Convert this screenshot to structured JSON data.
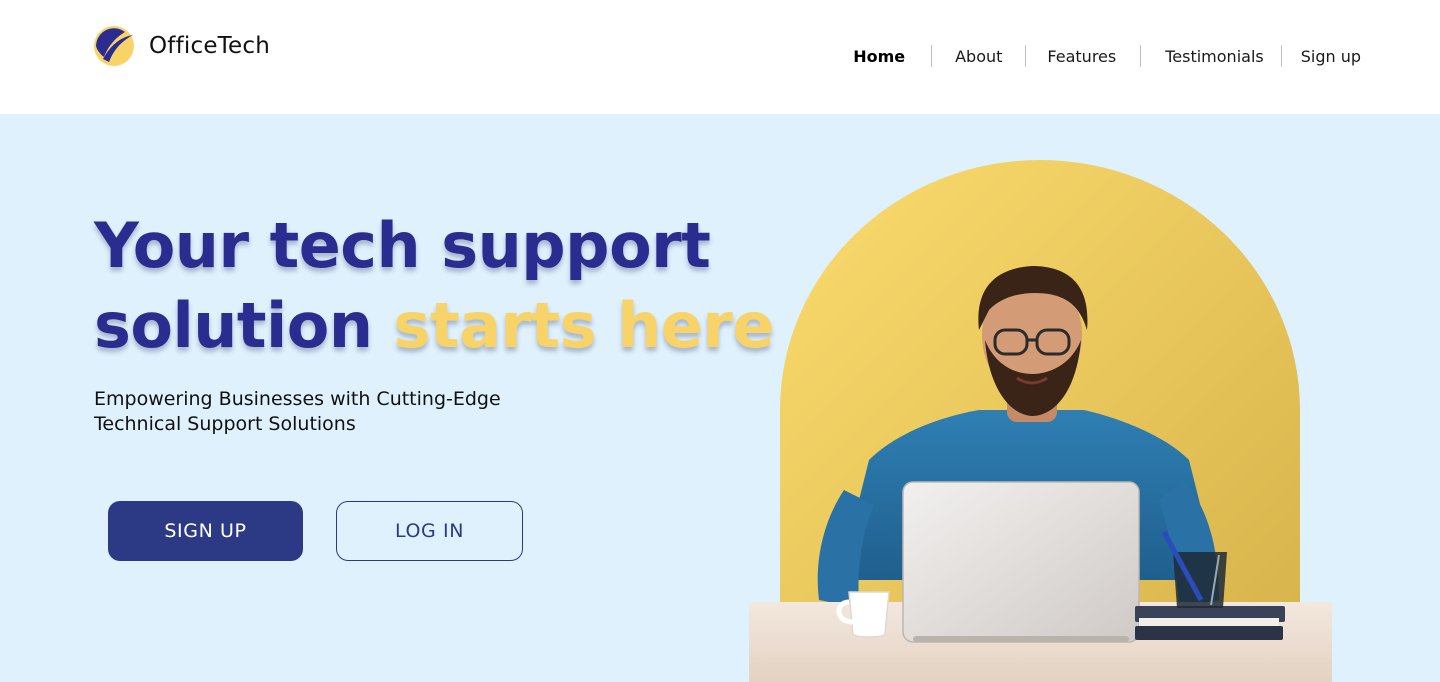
{
  "brand": {
    "name": "OfficeTech",
    "logo_icon": "crescent-swoosh-logo",
    "logo_colors": [
      "#f8d468",
      "#2a2d8f"
    ]
  },
  "nav": {
    "items": [
      {
        "label": "Home",
        "active": true
      },
      {
        "label": "About",
        "active": false
      },
      {
        "label": "Features",
        "active": false
      },
      {
        "label": "Testimonials",
        "active": false
      },
      {
        "label": "Sign up",
        "active": false
      }
    ]
  },
  "hero": {
    "headline_part1": "Your tech support",
    "headline_part2": "solution ",
    "headline_accent": "starts here",
    "subtitle_line1": "Empowering Businesses with Cutting-Edge",
    "subtitle_line2": "Technical Support Solutions",
    "signup_label": "SIGN UP",
    "login_label": "LOG IN",
    "image": "smiling man with glasses in blue shirt at desk with laptop, coffee cup, books and pen holder, in front of yellow arch"
  },
  "colors": {
    "primary": "#2c3a86",
    "headline": "#2a2d8f",
    "accent": "#f8d468",
    "hero_bg": "#dff1fd"
  }
}
